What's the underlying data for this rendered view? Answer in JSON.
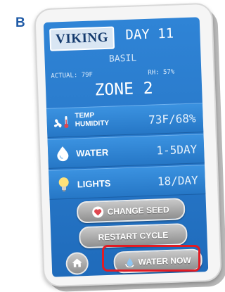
{
  "panel_letter": "B",
  "header": {
    "brand": "VIKING",
    "day": "DAY 11"
  },
  "plant": "BASIL",
  "readings": {
    "actual": "ACTUAL: 79F",
    "rh": "RH: 57%"
  },
  "zone": "ZONE 2",
  "rows": [
    {
      "label_line1": "TEMP",
      "label_line2": "HUMIDITY",
      "value": "73F/68%",
      "icon": "fan-thermometer-icon"
    },
    {
      "label": "WATER",
      "value": "1-5DAY",
      "icon": "water-drop-icon"
    },
    {
      "label": "LIGHTS",
      "value": "18/DAY",
      "icon": "light-bulb-icon"
    }
  ],
  "buttons": {
    "change_seed": "CHANGE SEED",
    "restart_cycle": "RESTART CYCLE",
    "water_now": "WATER NOW"
  },
  "colors": {
    "screen": "#2a7bcc",
    "highlight": "#e21b23",
    "seed_icon": "#e0464f"
  }
}
